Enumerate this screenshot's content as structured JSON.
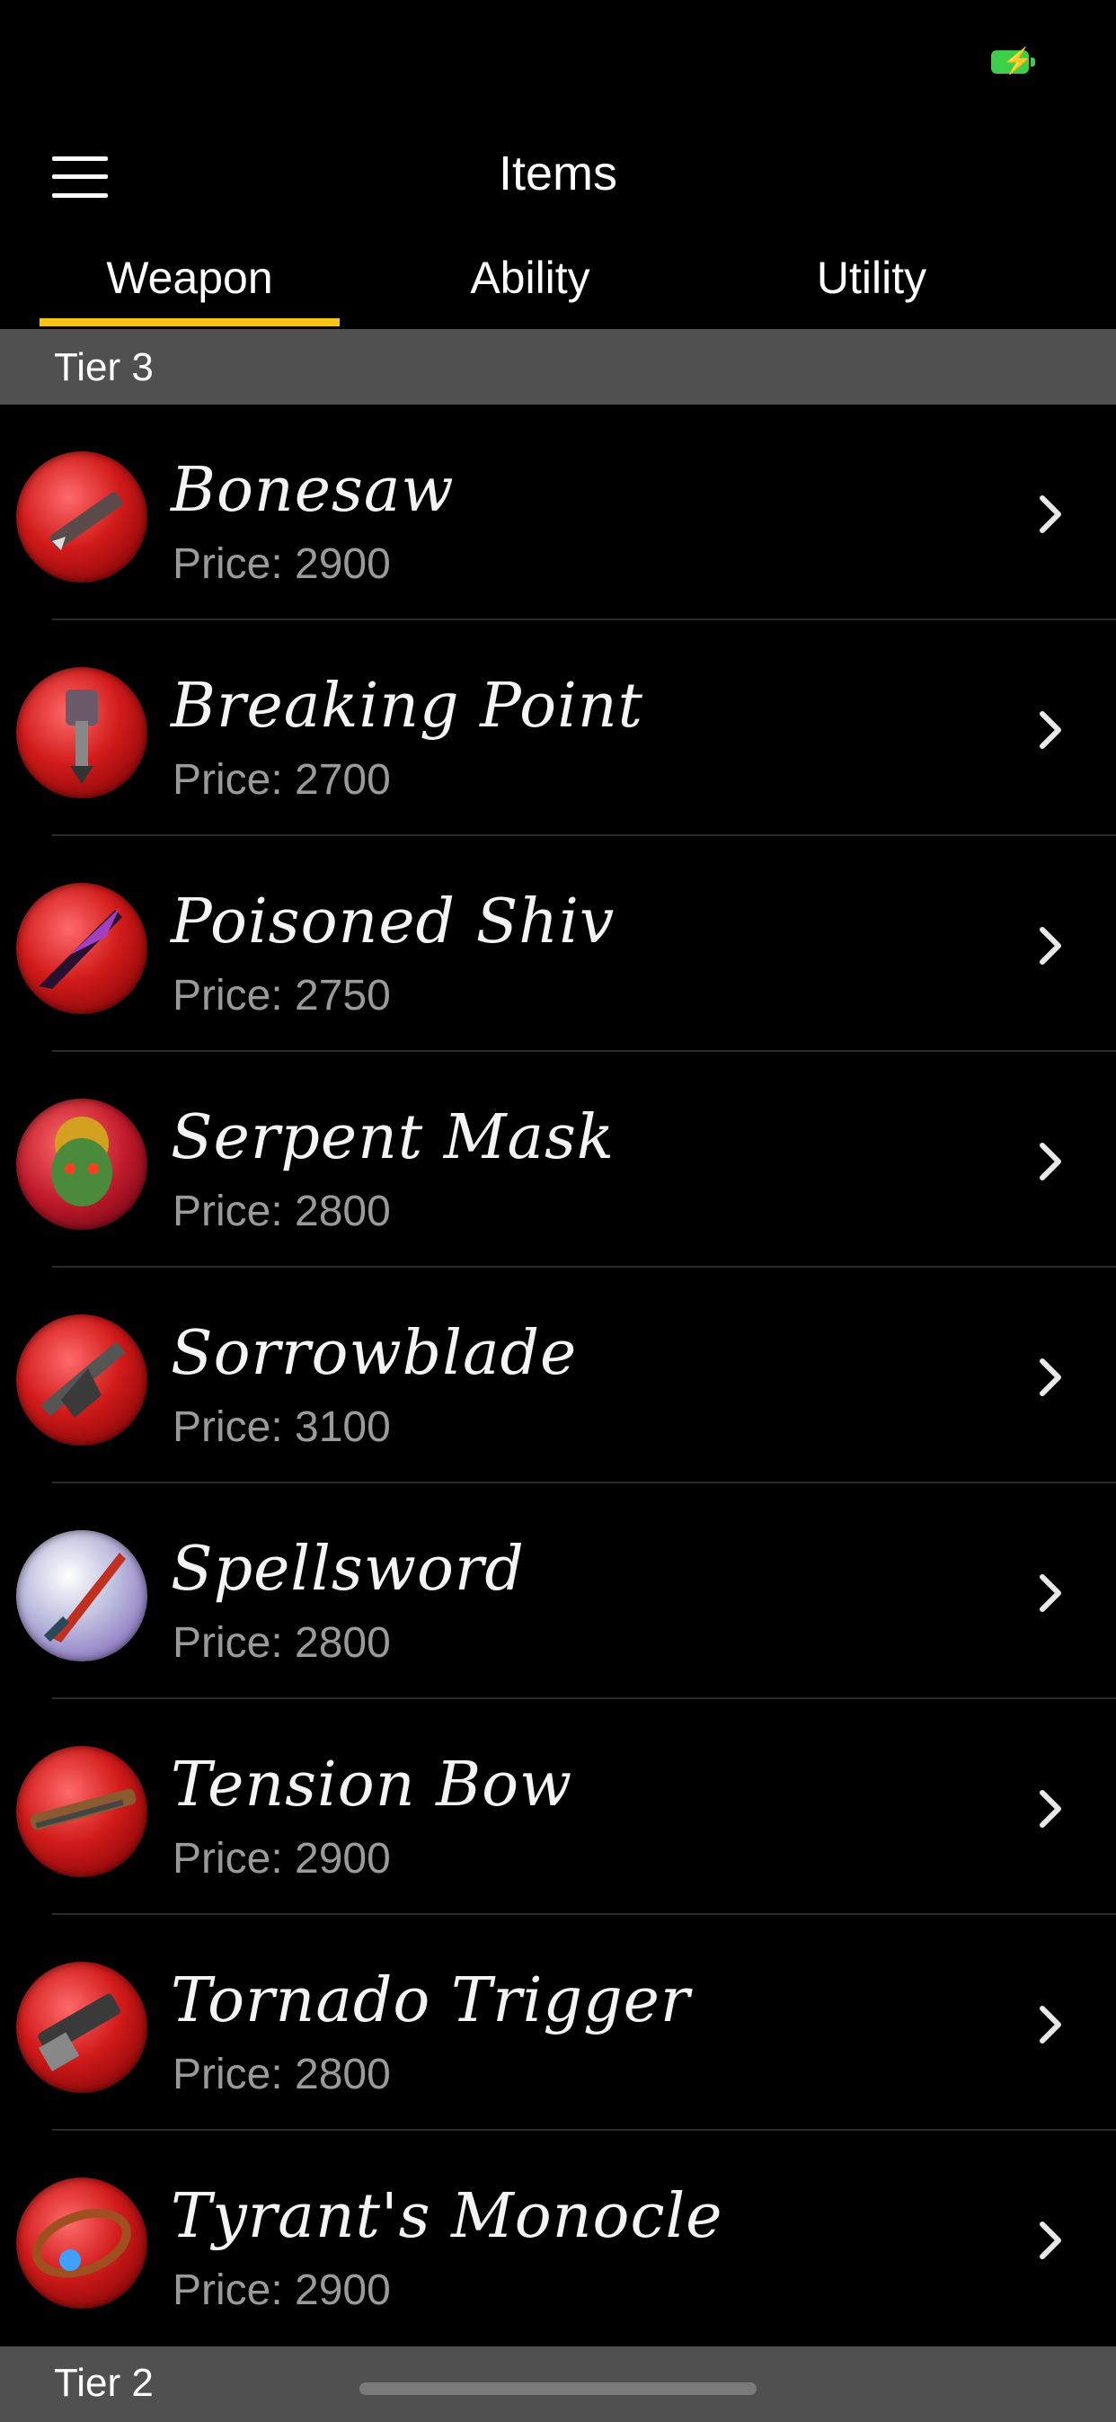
{
  "status_bar": {
    "battery_color": "#3ecf4a",
    "battery_icon": "battery-charging-icon"
  },
  "nav": {
    "title": "Items",
    "menu_icon": "hamburger-menu-icon"
  },
  "tabs": [
    {
      "label": "Weapon",
      "selected": true
    },
    {
      "label": "Ability",
      "selected": false
    },
    {
      "label": "Utility",
      "selected": false
    }
  ],
  "accent_color": "#f5c518",
  "sections": [
    {
      "title": "Tier 3",
      "items": [
        {
          "name": "Bonesaw",
          "price": "Price: 2900",
          "icon": "bonesaw-icon"
        },
        {
          "name": "Breaking Point",
          "price": "Price: 2700",
          "icon": "breaking-point-icon"
        },
        {
          "name": "Poisoned Shiv",
          "price": "Price: 2750",
          "icon": "poisoned-shiv-icon"
        },
        {
          "name": "Serpent Mask",
          "price": "Price: 2800",
          "icon": "serpent-mask-icon"
        },
        {
          "name": "Sorrowblade",
          "price": "Price: 3100",
          "icon": "sorrowblade-icon"
        },
        {
          "name": "Spellsword",
          "price": "Price: 2800",
          "icon": "spellsword-icon"
        },
        {
          "name": "Tension Bow",
          "price": "Price: 2900",
          "icon": "tension-bow-icon"
        },
        {
          "name": "Tornado Trigger",
          "price": "Price: 2800",
          "icon": "tornado-trigger-icon"
        },
        {
          "name": "Tyrant's Monocle",
          "price": "Price: 2900",
          "icon": "tyrants-monocle-icon"
        }
      ]
    },
    {
      "title": "Tier 2",
      "items": []
    }
  ]
}
